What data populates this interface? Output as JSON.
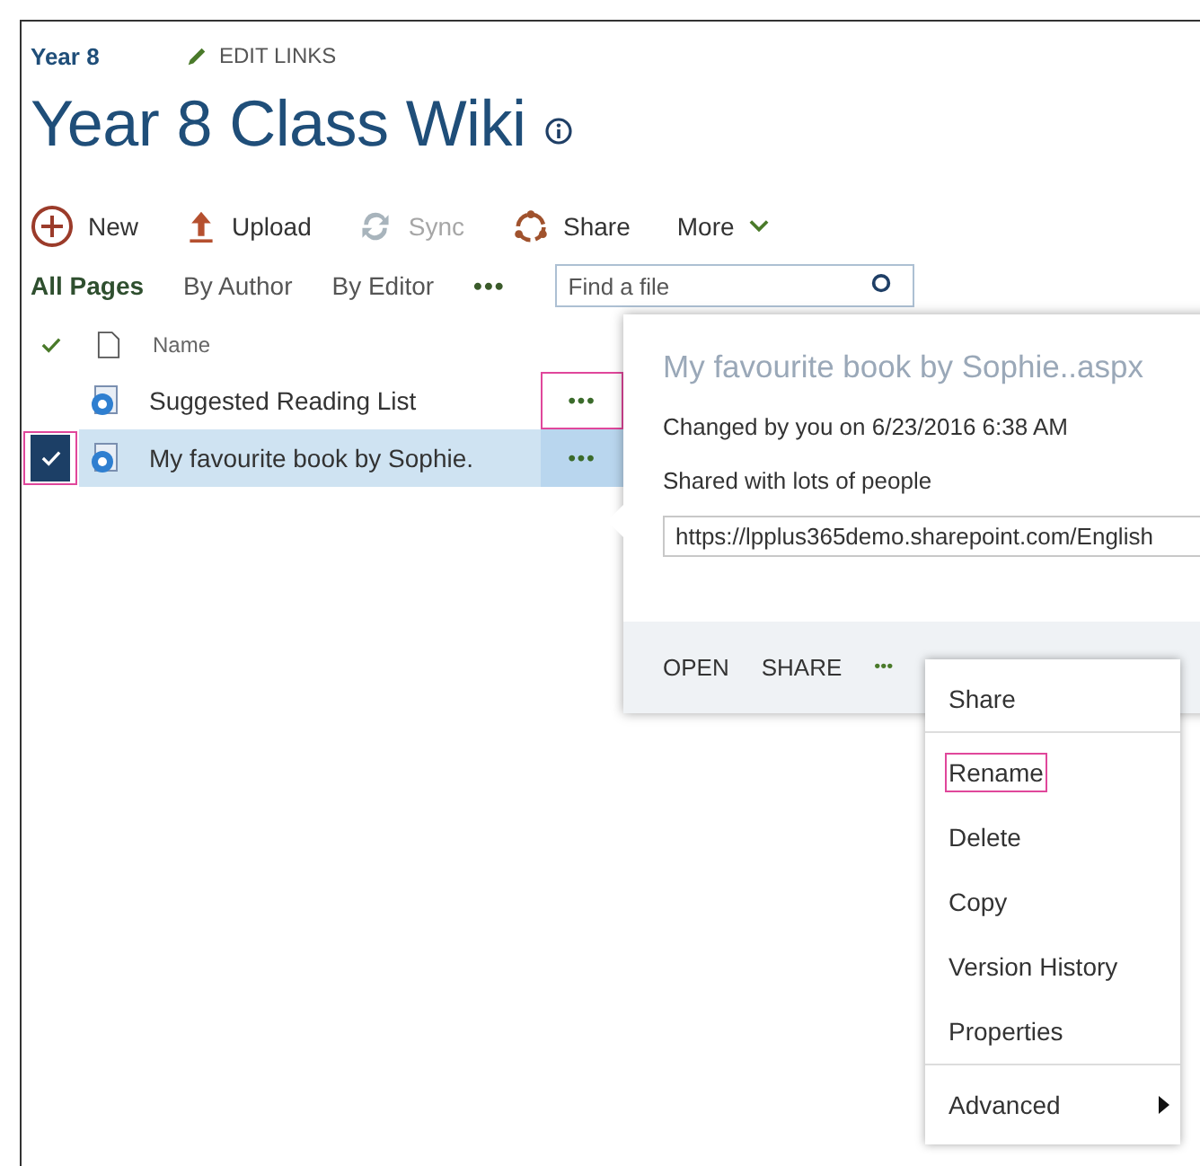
{
  "site": {
    "name": "Year 8",
    "edit_links": "EDIT LINKS",
    "title": "Year 8 Class Wiki"
  },
  "commands": [
    {
      "label": "New",
      "kind": "new",
      "disabled": false
    },
    {
      "label": "Upload",
      "kind": "upload",
      "disabled": false
    },
    {
      "label": "Sync",
      "kind": "sync",
      "disabled": true
    },
    {
      "label": "Share",
      "kind": "share",
      "disabled": false
    },
    {
      "label": "More",
      "kind": "more",
      "disabled": false
    }
  ],
  "views": [
    {
      "label": "All Pages",
      "selected": true
    },
    {
      "label": "By Author",
      "selected": false
    },
    {
      "label": "By Editor",
      "selected": false
    }
  ],
  "views_more": "•••",
  "search": {
    "placeholder": "Find a file"
  },
  "table": {
    "columns": [
      "Name"
    ],
    "rows": [
      {
        "name": "Suggested Reading List",
        "selected": false,
        "check_highlighted": false,
        "menu": "•••",
        "menu_highlighted": true
      },
      {
        "name": "My favourite book by Sophie.",
        "selected": true,
        "check_highlighted": true,
        "menu": "•••",
        "menu_highlighted": false
      }
    ]
  },
  "callout": {
    "title": "My favourite book by Sophie..aspx",
    "changed": "Changed by you on 6/23/2016 6:38 AM",
    "shared": "Shared with lots of people",
    "url": "https://lpplus365demo.sharepoint.com/English",
    "actions": [
      "OPEN",
      "SHARE"
    ],
    "more": "•••"
  },
  "menu": {
    "items": [
      {
        "label": "Share",
        "separator_after": true,
        "highlighted": false,
        "submenu": false
      },
      {
        "label": "Rename",
        "separator_after": false,
        "highlighted": true,
        "submenu": false
      },
      {
        "label": "Delete",
        "separator_after": false,
        "highlighted": false,
        "submenu": false
      },
      {
        "label": "Copy",
        "separator_after": false,
        "highlighted": false,
        "submenu": false
      },
      {
        "label": "Version History",
        "separator_after": false,
        "highlighted": false,
        "submenu": false
      },
      {
        "label": "Properties",
        "separator_after": true,
        "highlighted": false,
        "submenu": false
      },
      {
        "label": "Advanced",
        "separator_after": false,
        "highlighted": false,
        "submenu": true
      }
    ]
  }
}
